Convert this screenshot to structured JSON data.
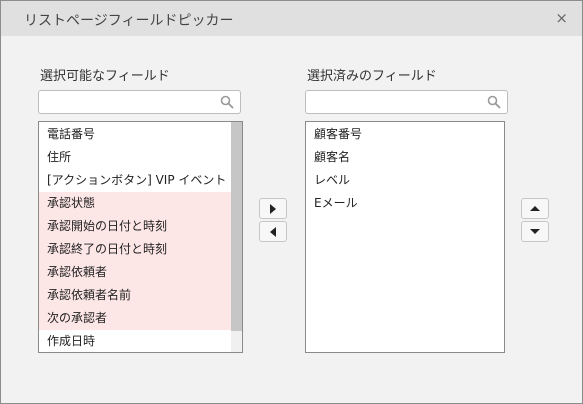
{
  "dialog": {
    "title": "リストページフィールドピッカー",
    "close_glyph": "×"
  },
  "available": {
    "label": "選択可能なフィールド",
    "search_value": "",
    "items": [
      {
        "label": "電話番号",
        "highlighted": false
      },
      {
        "label": "住所",
        "highlighted": false
      },
      {
        "label": "[アクションボタン] VIP イベント",
        "highlighted": false
      },
      {
        "label": "承認状態",
        "highlighted": true
      },
      {
        "label": "承認開始の日付と時刻",
        "highlighted": true
      },
      {
        "label": "承認終了の日付と時刻",
        "highlighted": true
      },
      {
        "label": "承認依頼者",
        "highlighted": true
      },
      {
        "label": "承認依頼者名前",
        "highlighted": true
      },
      {
        "label": "次の承認者",
        "highlighted": true
      },
      {
        "label": "作成日時",
        "highlighted": false
      }
    ]
  },
  "selected": {
    "label": "選択済みのフィールド",
    "search_value": "",
    "items": [
      {
        "label": "顧客番号"
      },
      {
        "label": "顧客名"
      },
      {
        "label": "レベル"
      },
      {
        "label": "Eメール"
      }
    ]
  },
  "icons": {
    "search": "search-icon",
    "move_right": "triangle-right-icon",
    "move_left": "triangle-left-icon",
    "move_up": "triangle-up-icon",
    "move_down": "triangle-down-icon",
    "close": "close-icon"
  },
  "colors": {
    "highlight_row": "#fde6e6",
    "titlebar": "#e0e0e0",
    "dialog_bg": "#f2f2f2"
  }
}
